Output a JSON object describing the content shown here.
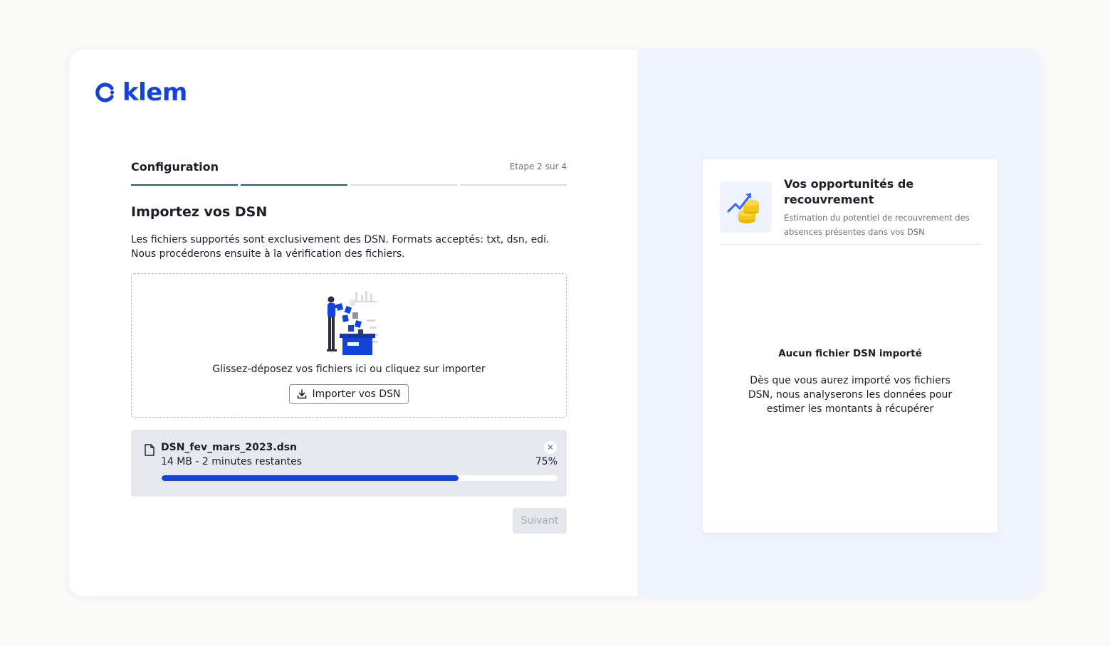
{
  "brand": {
    "name": "klem",
    "color": "#1443d9"
  },
  "wizard": {
    "title": "Configuration",
    "step_label": "Etape 2 sur 4",
    "current_step": 2,
    "total_steps": 4
  },
  "import": {
    "title": "Importez vos DSN",
    "description": "Les fichiers supportés sont exclusivement des DSN. Formats acceptés: txt, dsn, edi. Nous procéderons ensuite à la vérification des fichiers.",
    "drop_text": "Glissez-déposez vos fichiers ici ou cliquez sur importer",
    "button_label": "Importer vos DSN",
    "button_icon": "download-icon",
    "illustration": "person-uploading-files-illustration"
  },
  "upload": {
    "file_name": "DSN_fev_mars_2023.dsn",
    "meta": "14 MB - 2 minutes restantes",
    "percent_label": "75%",
    "progress": 0.75,
    "file_icon": "file-icon",
    "close_icon": "close-icon"
  },
  "next_button": {
    "label": "Suivant",
    "disabled": true
  },
  "opportunities": {
    "title": "Vos opportunités de recouvrement",
    "subtitle": "Estimation du potentiel de recouvrement des absences présentes dans vos DSN",
    "icon": "coins-growth-icon",
    "empty_title": "Aucun fichier DSN importé",
    "empty_text": "Dès que vous aurez importé vos fichiers DSN, nous analyserons les données pour estimer les montants à récupérer"
  },
  "colors": {
    "accent": "#1443d9",
    "progress_active": "#1a4fc9",
    "panel_bg": "#eff3fd",
    "file_card_bg": "#e8e8f0"
  }
}
